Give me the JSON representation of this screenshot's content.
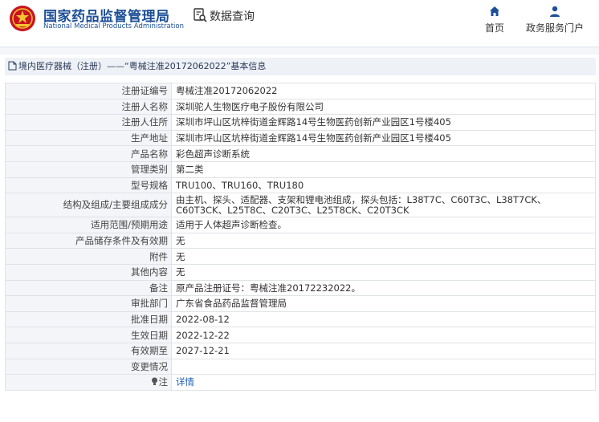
{
  "header": {
    "brand_cn": "国家药品监督管理局",
    "brand_en": "National Medical Products Administration",
    "query_label": "数据查询",
    "nav": [
      {
        "label": "首页",
        "icon": "home-icon"
      },
      {
        "label": "政务服务门户",
        "icon": "user-icon"
      }
    ]
  },
  "panel": {
    "title": "境内医疗器械（注册）——“粤械注准20172062022”基本信息",
    "rows": [
      {
        "label": "注册证编号",
        "value": "粤械注准20172062022"
      },
      {
        "label": "注册人名称",
        "value": "深圳驼人生物医疗电子股份有限公司"
      },
      {
        "label": "注册人住所",
        "value": "深圳市坪山区坑梓街道金辉路14号生物医药创新产业园区1号楼405"
      },
      {
        "label": "生产地址",
        "value": "深圳市坪山区坑梓街道金辉路14号生物医药创新产业园区1号楼405"
      },
      {
        "label": "产品名称",
        "value": "彩色超声诊断系统"
      },
      {
        "label": "管理类别",
        "value": "第二类"
      },
      {
        "label": "型号规格",
        "value": "TRU100、TRU160、TRU180"
      },
      {
        "label": "结构及组成/主要组成成分",
        "value": "由主机、探头、适配器、支架和锂电池组成，探头包括：L38T7C、C60T3C、L38T7CK、C60T3CK、L25T8C、C20T3C、L25T8CK、C20T3CK"
      },
      {
        "label": "适用范围/预期用途",
        "value": "适用于人体超声诊断检查。"
      },
      {
        "label": "产品储存条件及有效期",
        "value": "无"
      },
      {
        "label": "附件",
        "value": "无"
      },
      {
        "label": "其他内容",
        "value": "无"
      },
      {
        "label": "备注",
        "value": "原产品注册证号：粤械注准20172232022。"
      },
      {
        "label": "审批部门",
        "value": "广东省食品药品监督管理局"
      },
      {
        "label": "批准日期",
        "value": "2022-08-12"
      },
      {
        "label": "生效日期",
        "value": "2022-12-22"
      },
      {
        "label": "有效期至",
        "value": "2027-12-21"
      },
      {
        "label": "变更情况",
        "value": ""
      }
    ],
    "note_label": "注",
    "note_link": "详情"
  }
}
